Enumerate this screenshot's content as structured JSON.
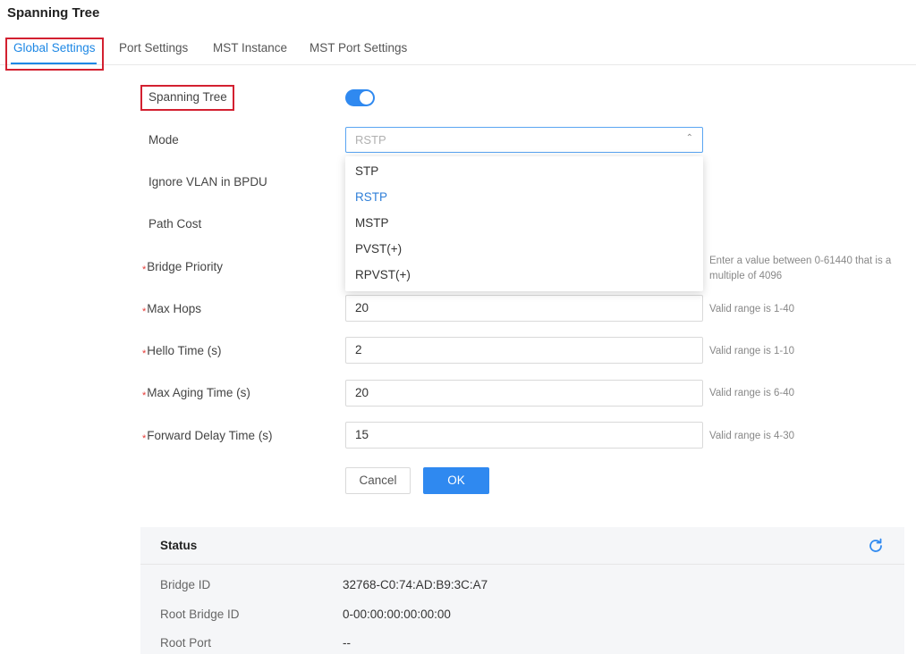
{
  "page": {
    "title": "Spanning Tree"
  },
  "tabs": [
    {
      "label": "Global Settings"
    },
    {
      "label": "Port Settings"
    },
    {
      "label": "MST Instance"
    },
    {
      "label": "MST Port Settings"
    }
  ],
  "form": {
    "spanning_tree_label": "Spanning Tree",
    "spanning_tree_enabled": true,
    "mode_label": "Mode",
    "mode_value": "RSTP",
    "ignore_vlan_label": "Ignore VLAN in BPDU",
    "path_cost_label": "Path Cost",
    "bridge_priority_label": "Bridge Priority",
    "bridge_priority_hint_line1": "Enter a value between 0-61440 that is a",
    "bridge_priority_hint_line2": "multiple of 4096",
    "max_hops_label": "Max Hops",
    "max_hops_value": "20",
    "max_hops_hint": "Valid range is 1-40",
    "hello_time_label": "Hello Time (s)",
    "hello_time_value": "2",
    "hello_time_hint": "Valid range is 1-10",
    "max_aging_label": "Max Aging Time (s)",
    "max_aging_value": "20",
    "max_aging_hint": "Valid range is 6-40",
    "forward_delay_label": "Forward Delay Time (s)",
    "forward_delay_value": "15",
    "forward_delay_hint": "Valid range is 4-30",
    "required_mark": "*"
  },
  "mode_options": [
    "STP",
    "RSTP",
    "MSTP",
    "PVST(+)",
    "RPVST(+)"
  ],
  "buttons": {
    "cancel": "Cancel",
    "ok": "OK"
  },
  "status": {
    "title": "Status",
    "rows": [
      {
        "key": "Bridge ID",
        "value": "32768-C0:74:AD:B9:3C:A7"
      },
      {
        "key": "Root Bridge ID",
        "value": "0-00:00:00:00:00:00"
      },
      {
        "key": "Root Port",
        "value": "--"
      }
    ]
  },
  "colors": {
    "accent": "#2f89f0",
    "highlight_box": "#d32030",
    "required": "#e53935"
  },
  "icons": {
    "refresh": "refresh-icon",
    "chevron": "chevron-up-icon"
  }
}
